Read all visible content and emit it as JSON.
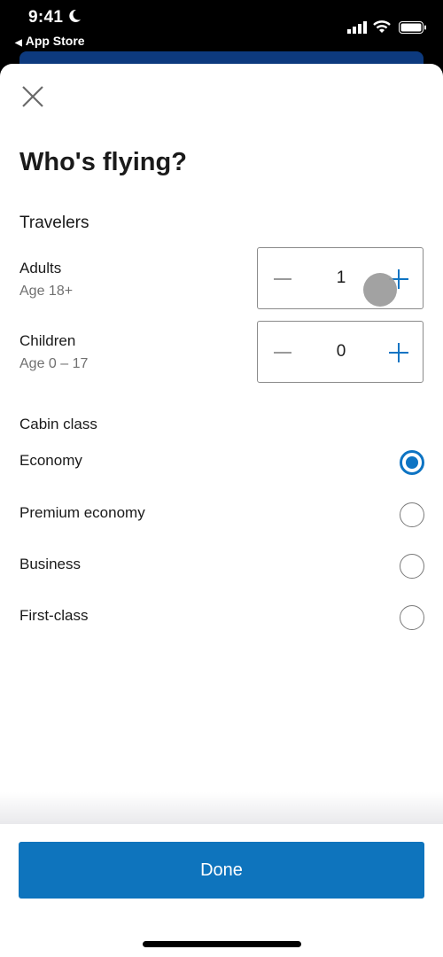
{
  "status_bar": {
    "time": "9:41",
    "back_label": "App Store"
  },
  "sheet": {
    "title": "Who's flying?",
    "travelers": {
      "heading": "Travelers",
      "adults": {
        "label": "Adults",
        "sub": "Age 18+",
        "value": "1"
      },
      "children": {
        "label": "Children",
        "sub": "Age 0 – 17",
        "value": "0"
      }
    },
    "cabin": {
      "heading": "Cabin class",
      "options": [
        {
          "label": "Economy",
          "selected": true
        },
        {
          "label": "Premium economy",
          "selected": false
        },
        {
          "label": "Business",
          "selected": false
        },
        {
          "label": "First-class",
          "selected": false
        }
      ]
    },
    "done_label": "Done"
  },
  "colors": {
    "accent": "#0e74bd",
    "header_bg": "#0d3a7e"
  }
}
